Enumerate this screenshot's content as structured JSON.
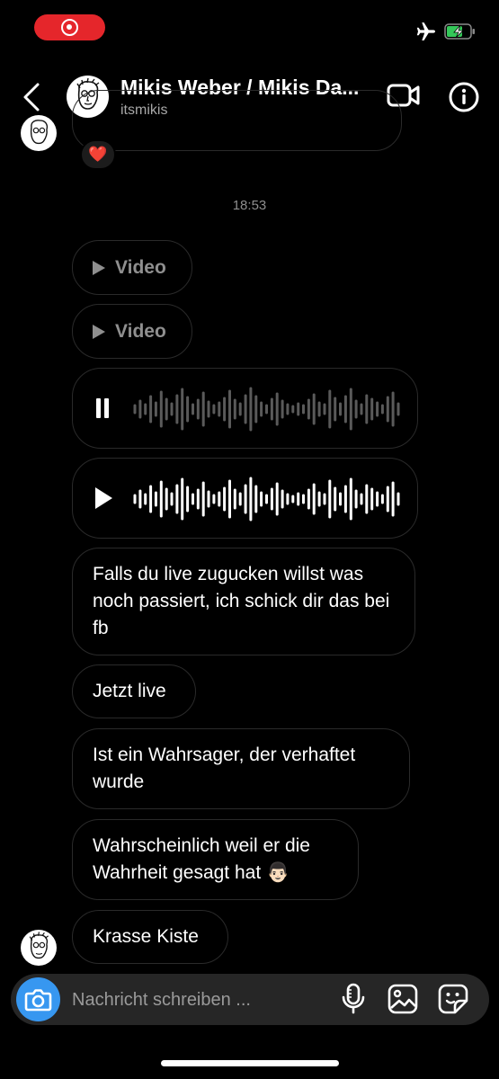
{
  "status_bar": {
    "recording_icon": "record-icon",
    "airplane_icon": "airplane-icon",
    "battery_icon": "battery-charging-icon",
    "battery_color": "#34c759"
  },
  "header": {
    "name": "Mikis Weber / Mikis Da...",
    "handle": "itsmikis",
    "back_icon": "chevron-left-icon",
    "video_icon": "video-camera-icon",
    "info_icon": "info-icon"
  },
  "messages": {
    "reaction": "❤️",
    "timestamp": "18:53",
    "videos": [
      {
        "label": "Video"
      },
      {
        "label": "Video"
      }
    ],
    "voice_notes": [
      {
        "state": "playing",
        "icon": "pause-icon"
      },
      {
        "state": "paused",
        "icon": "play-icon"
      }
    ],
    "texts": [
      "Falls du live zugucken willst was noch passiert, ich schick dir das bei fb",
      "Jetzt live",
      "Ist ein Wahrsager, der verhaftet wurde",
      "Wahrscheinlich weil er die Wahrheit gesagt hat 👨🏻",
      "Krasse Kiste"
    ]
  },
  "composer": {
    "placeholder": "Nachricht schreiben ...",
    "camera_icon": "camera-icon",
    "mic_icon": "microphone-icon",
    "gallery_icon": "image-icon",
    "sticker_icon": "sticker-icon",
    "accent_color": "#3797f0"
  }
}
